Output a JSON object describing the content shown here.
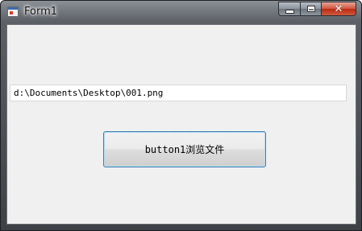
{
  "window": {
    "title": "Form1",
    "app_icon": "form-app-icon",
    "controls": {
      "minimize_icon": "minimize-icon",
      "maximize_icon": "maximize-icon",
      "close_glyph": "✕"
    }
  },
  "form": {
    "file_path_value": "d:\\Documents\\Desktop\\001.png",
    "browse_button_label": "button1浏览文件"
  },
  "colors": {
    "client_background": "#f0f0f0",
    "button_focus_border": "#3c7fb1",
    "close_button_red": "#c7432b"
  }
}
